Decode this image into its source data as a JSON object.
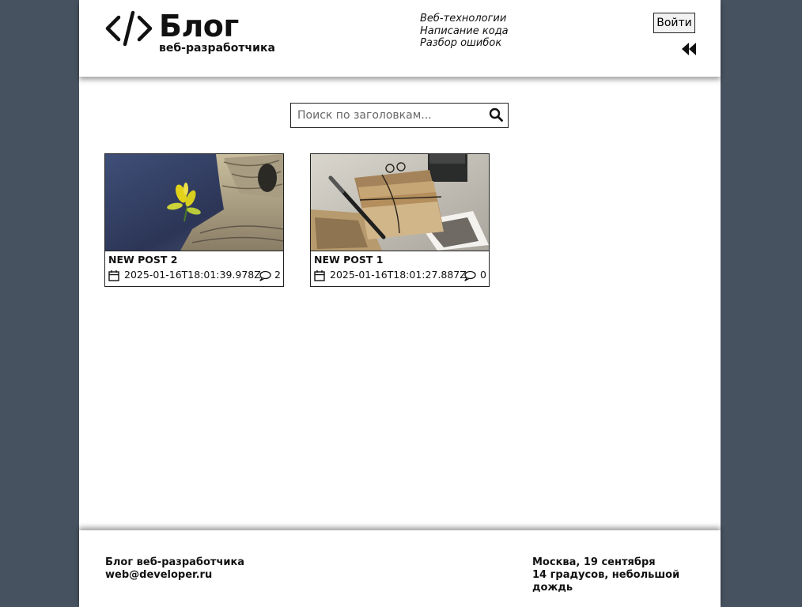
{
  "header": {
    "logo_title": "Блог",
    "logo_subtitle": "веб-разработчика",
    "nav": [
      "Веб-технологии",
      "Написание кода",
      "Разбор ошибок"
    ],
    "login_label": "Войти"
  },
  "search": {
    "placeholder": "Поиск по заголовкам...",
    "value": ""
  },
  "posts": [
    {
      "title": "NEW POST 2",
      "date": "2025-01-16T18:01:39.978Z",
      "comments": "2",
      "image": "yellow plant on wood"
    },
    {
      "title": "NEW POST 1",
      "date": "2025-01-16T18:01:27.887Z",
      "comments": "0",
      "image": "letters, pen and photos"
    }
  ],
  "footer": {
    "left": [
      "Блог веб-разработчика",
      "web@developer.ru"
    ],
    "right": [
      "Москва, 19 сентября",
      "14 градусов, небольшой дождь"
    ]
  },
  "colors": {
    "background": "#46525f",
    "page": "#ffffff",
    "text": "#111111",
    "border": "#222222"
  },
  "icons": [
    "code-logo-icon",
    "double-chevron-left-icon",
    "search-icon",
    "calendar-icon",
    "comment-icon"
  ]
}
